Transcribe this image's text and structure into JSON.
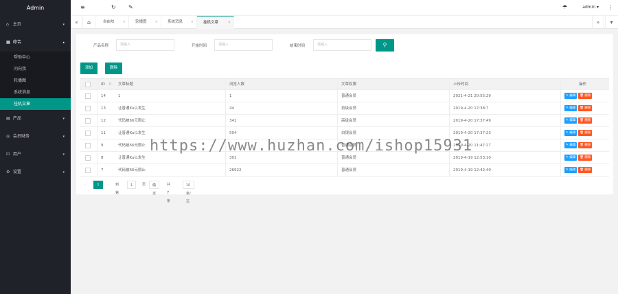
{
  "app": {
    "title": "Admin"
  },
  "sidebar": {
    "items": [
      {
        "label": "主页",
        "icon": "home-icon",
        "arrow": "▾"
      },
      {
        "label": "综合",
        "icon": "grid-icon",
        "arrow": "▴"
      }
    ],
    "sub_items": [
      "帮助中心",
      "问向我",
      "轮播图",
      "系统消息",
      "挂机文章"
    ],
    "items_after": [
      {
        "label": "产品",
        "icon": "product-icon",
        "arrow": "▾"
      },
      {
        "label": "会员财务",
        "icon": "finance-icon",
        "arrow": "▾"
      },
      {
        "label": "用户",
        "icon": "user-icon",
        "arrow": "▾"
      },
      {
        "label": "设置",
        "icon": "gear-icon",
        "arrow": "▾"
      }
    ]
  },
  "header": {
    "menu_icon": "≡",
    "refresh_icon": "↻",
    "brush_icon": "✎",
    "theme_icon": "☂",
    "user": "admin ▾",
    "more_icon": "⋮"
  },
  "tabs": {
    "prev": "«",
    "home_icon": "⌂",
    "next": "»",
    "down": "▾",
    "items": [
      "自由块",
      "轮播图",
      "系统消息",
      "挂机文章"
    ]
  },
  "filter": {
    "product_label": "产品名称",
    "product_placeholder": "请输入",
    "start_label": "开始时间",
    "start_placeholder": "请输入",
    "end_label": "结束时间",
    "end_placeholder": "请输入",
    "search_icon": "⚲"
  },
  "actions": {
    "add": "添加",
    "delete": "删除"
  },
  "table": {
    "headers": [
      "ID",
      "文章标题",
      "浏览人数",
      "文章权限",
      "上传时间",
      "操作"
    ],
    "sort_icon": "⇕",
    "edit_label": "✎ 编辑",
    "delete_label": "🗑 删除",
    "rows": [
      {
        "id": "14",
        "title": "1",
        "views": "1",
        "perm": "普通会员",
        "time": "2021-4-21 20:55:29"
      },
      {
        "id": "13",
        "title": "让普通Ku以发生",
        "views": "44",
        "perm": "初级会员",
        "time": "2019-4-20 17:38:7"
      },
      {
        "id": "12",
        "title": "代码被66元限止",
        "views": "341",
        "perm": "高级会员",
        "time": "2019-4-20 17:37:49"
      },
      {
        "id": "11",
        "title": "让普通Ku以发生",
        "views": "504",
        "perm": "白银会员",
        "time": "2019-4-20 17:37:23"
      },
      {
        "id": "9",
        "title": "代码被66元限止",
        "views": "",
        "perm": "普通会员",
        "time": "2019-4-20 11:47:27"
      },
      {
        "id": "8",
        "title": "让普通Ku以发生",
        "views": "301",
        "perm": "普通会员",
        "time": "2019-4-19 12:53:10"
      },
      {
        "id": "7",
        "title": "代码被66元限止",
        "views": "26922",
        "perm": "普通会员",
        "time": "2019-4-19 12:42:40"
      }
    ]
  },
  "pager": {
    "prev": "‹",
    "current": "1",
    "next": "›",
    "goto_label": "到第",
    "goto_value": "1",
    "page_unit": "页",
    "confirm": "确定",
    "total": "共 7 条",
    "per_page": "10 条/页"
  },
  "watermark": "https://www.huzhan.com/ishop15931"
}
